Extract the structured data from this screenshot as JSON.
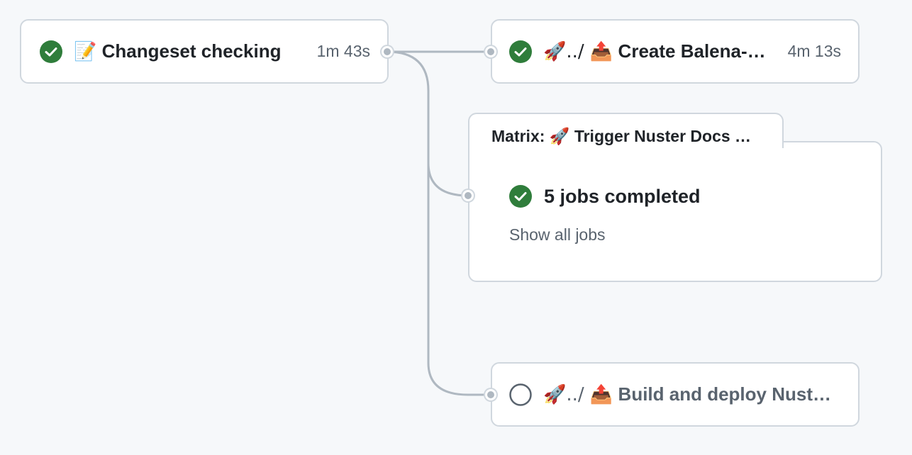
{
  "colors": {
    "success": "#1a7f37",
    "success_dark": "#2f7d3b",
    "pending": "#59636e",
    "connector": "#afb8c1",
    "border": "#d0d7de",
    "background": "#f6f8fa"
  },
  "jobs": [
    {
      "emoji": "📝",
      "name": "Changeset checking",
      "duration": "1m 43s",
      "status": "success",
      "status_icon": "check-circle-icon"
    },
    {
      "emoji": "🚀../ 📤",
      "name": "Create Balena-…",
      "duration": "4m 13s",
      "status": "success",
      "status_icon": "check-circle-icon"
    },
    {
      "emoji": "🚀../ 📤",
      "name": "Build and deploy Nust…",
      "duration": "",
      "status": "pending",
      "status_icon": "empty-circle-icon"
    }
  ],
  "matrix": {
    "title": "Matrix: 🚀 Trigger Nuster Docs …",
    "summary": "5 jobs completed",
    "status_icon": "check-circle-icon",
    "show_all_label": "Show all jobs"
  }
}
